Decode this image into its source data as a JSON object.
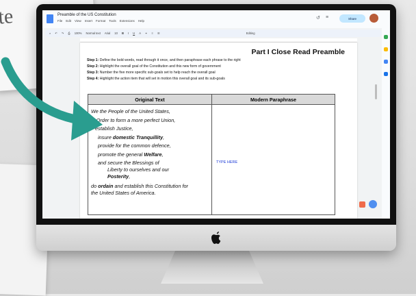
{
  "background": {
    "card_text": "te"
  },
  "window": {
    "doc_title": "Preamble of the US Constitution",
    "menus": [
      "File",
      "Edit",
      "View",
      "Insert",
      "Format",
      "Tools",
      "Extensions",
      "Help"
    ],
    "share_label": "Share",
    "zoom": "100%",
    "style": "Normal text",
    "font": "Arial",
    "font_size": "10",
    "editing": "Editing"
  },
  "document": {
    "title": "Part I Close Read Preamble",
    "steps": [
      {
        "label": "Step 1:",
        "text": " Define the bold words, read through it once, and then paraphrase each phrase to the right"
      },
      {
        "label": "Step 2:",
        "text": " Highlight the overall goal of the Constitution and this new form of government"
      },
      {
        "label": "Step 3:",
        "text": " Number the five more specific sub-goals set to help reach the overall goal"
      },
      {
        "label": "Step 4:",
        "text": " Highlight the action item that will set in motion this overall goal and its sub-goals"
      }
    ],
    "table": {
      "headers": [
        "Original Text",
        "Modern Paraphrase"
      ],
      "lines": {
        "l1": "We the People of the United States,",
        "l2": "in Order to form a more perfect Union,",
        "l3": "establish Justice,",
        "l4a": "insure ",
        "l4b": "domestic Tranquillity",
        "l4c": ",",
        "l5": "provide for the common defence,",
        "l6a": "promote the general ",
        "l6b": "Welfare",
        "l6c": ",",
        "l7": "and secure the Blessings of",
        "l8": "Liberty to ourselves and our",
        "l9": "Posterity",
        "l9c": ",",
        "l10a": "do ",
        "l10b": "ordain",
        "l10c": " and establish this Constitution for",
        "l11": "the United States of America."
      },
      "placeholder": "TYPE HERE"
    }
  },
  "colors": {
    "arrow": "#2a9d8f",
    "share_bg": "#c2e7ff",
    "placeholder": "#1a39d6"
  }
}
